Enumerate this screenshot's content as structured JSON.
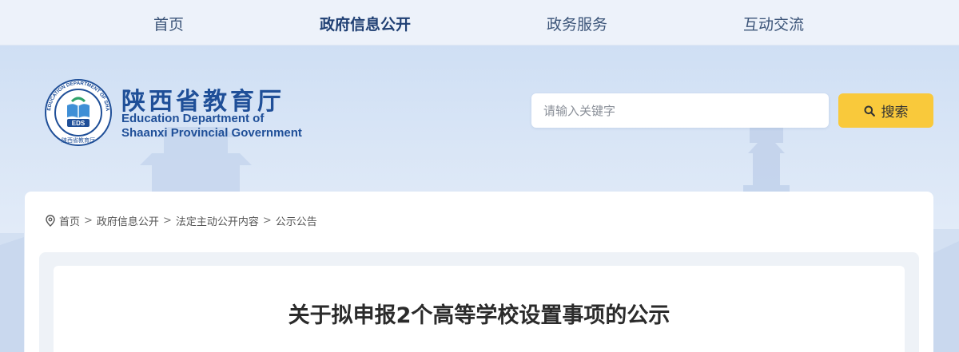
{
  "nav": {
    "items": [
      {
        "label": "首页"
      },
      {
        "label": "政府信息公开"
      },
      {
        "label": "政务服务"
      },
      {
        "label": "互动交流"
      }
    ],
    "active_index": 1
  },
  "header": {
    "logo_text": "EDS",
    "logo_ring_text": "EDUCATION DEPARTMENT OF SHAANXI",
    "logo_ring_text_cn": "陕西省教育厅",
    "brand_cn": "陕西省教育厅",
    "brand_en_line1": "Education Department of",
    "brand_en_line2": "Shaanxi Provincial Government"
  },
  "search": {
    "placeholder": "请输入关键字",
    "value": "",
    "button_label": "搜索"
  },
  "breadcrumb": {
    "items": [
      "首页",
      "政府信息公开",
      "法定主动公开内容",
      "公示公告"
    ],
    "separator": ">"
  },
  "article": {
    "title": "关于拟申报2个高等学校设置事项的公示"
  },
  "colors": {
    "brand_blue": "#1f4f98",
    "search_button": "#f9c93b",
    "nav_text": "#3b5478"
  },
  "icons": {
    "search": "search-icon",
    "location": "location-pin-icon"
  }
}
